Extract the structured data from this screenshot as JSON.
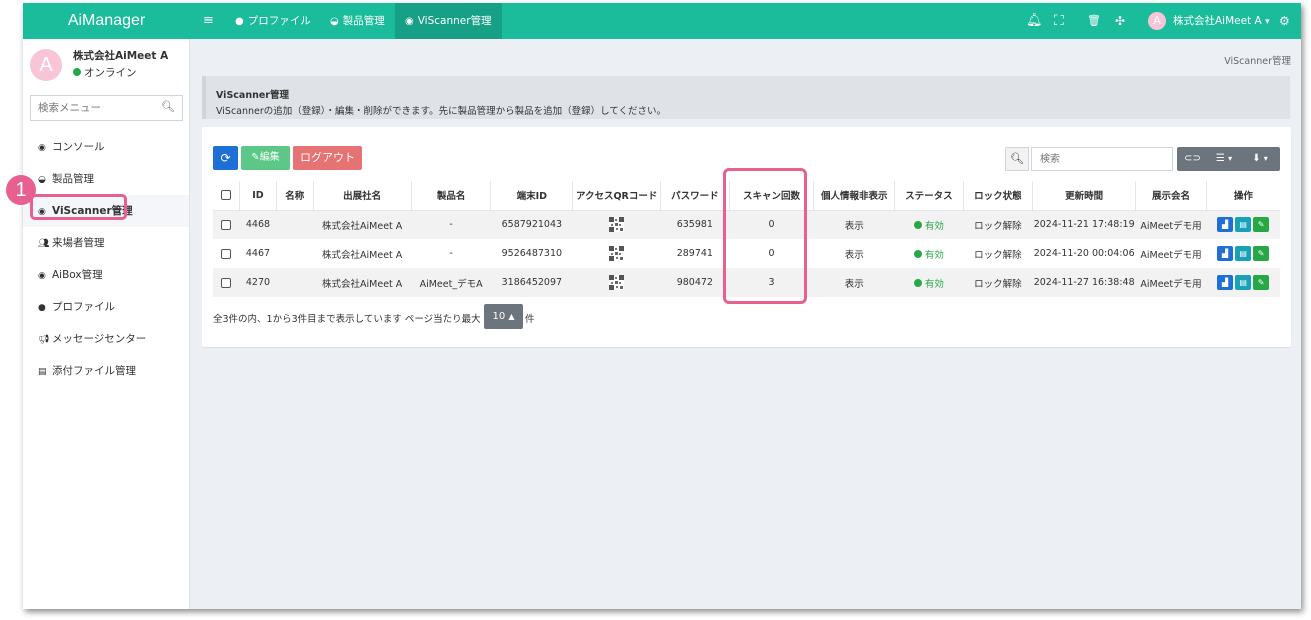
{
  "brand": "AiManager",
  "topnav": {
    "menu_icon": "bars-icon",
    "items": [
      {
        "label": "プロファイル",
        "icon": "user-icon"
      },
      {
        "label": "製品管理",
        "icon": "box-icon"
      },
      {
        "label": "ViScanner管理",
        "icon": "dashboard-icon"
      }
    ],
    "user_initial": "A",
    "user_name": "株式会社AiMeet A",
    "user_caret": "▾"
  },
  "sidebar": {
    "avatar_initial": "A",
    "user": "株式会社AiMeet A",
    "status": "オンライン",
    "search_placeholder": "検索メニュー",
    "items": [
      {
        "label": "コンソール",
        "icon": "dashboard-icon"
      },
      {
        "label": "製品管理",
        "icon": "box-icon"
      },
      {
        "label": "ViScanner管理",
        "icon": "dashboard-icon"
      },
      {
        "label": "来場者管理",
        "icon": "users-icon"
      },
      {
        "label": "AiBox管理",
        "icon": "dashboard-icon"
      },
      {
        "label": "プロファイル",
        "icon": "user-icon"
      },
      {
        "label": "メッセージセンター",
        "icon": "bullhorn-icon"
      },
      {
        "label": "添付ファイル管理",
        "icon": "file-icon"
      }
    ]
  },
  "callout_number": "1",
  "breadcrumb": "ViScanner管理",
  "info": {
    "title": "ViScanner管理",
    "description": "ViScannerの追加（登録）・編集・削除ができます。先に製品管理から製品を追加（登録）してください。"
  },
  "toolbar": {
    "refresh_icon": "refresh-icon",
    "edit_label": "編集",
    "logout_label": "ログアウト",
    "search_placeholder": "検索",
    "caret": "▾"
  },
  "table": {
    "headers": [
      "ID",
      "名称",
      "出展社名",
      "製品名",
      "端末ID",
      "アクセスQRコード",
      "パスワード",
      "スキャン回数",
      "個人情報非表示",
      "ステータス",
      "ロック状態",
      "更新時間",
      "展示会名",
      "操作"
    ],
    "rows": [
      {
        "id": "4468",
        "name": "",
        "exhibitor": "株式会社AiMeet A",
        "product": "-",
        "device_id": "6587921043",
        "password": "635981",
        "scans": "0",
        "privacy": "表示",
        "status": "有効",
        "lock": "ロック解除",
        "updated": "2024-11-21 17:48:19",
        "exhibition": "AiMeetデモ用"
      },
      {
        "id": "4467",
        "name": "",
        "exhibitor": "株式会社AiMeet A",
        "product": "-",
        "device_id": "9526487310",
        "password": "289741",
        "scans": "0",
        "privacy": "表示",
        "status": "有効",
        "lock": "ロック解除",
        "updated": "2024-11-20 00:04:06",
        "exhibition": "AiMeetデモ用"
      },
      {
        "id": "4270",
        "name": "",
        "exhibitor": "株式会社AiMeet A",
        "product": "AiMeet_デモA",
        "device_id": "3186452097",
        "password": "980472",
        "scans": "3",
        "privacy": "表示",
        "status": "有効",
        "lock": "ロック解除",
        "updated": "2024-11-27 16:38:48",
        "exhibition": "AiMeetデモ用"
      }
    ]
  },
  "pagination": {
    "summary": "全3件の内、1から3件目まで表示しています ページ当たり最大",
    "page_size": "10",
    "suffix": "件"
  },
  "colors": {
    "topbar": "#1abc9c",
    "highlight": "#e8608f",
    "status_green": "#28a745"
  }
}
